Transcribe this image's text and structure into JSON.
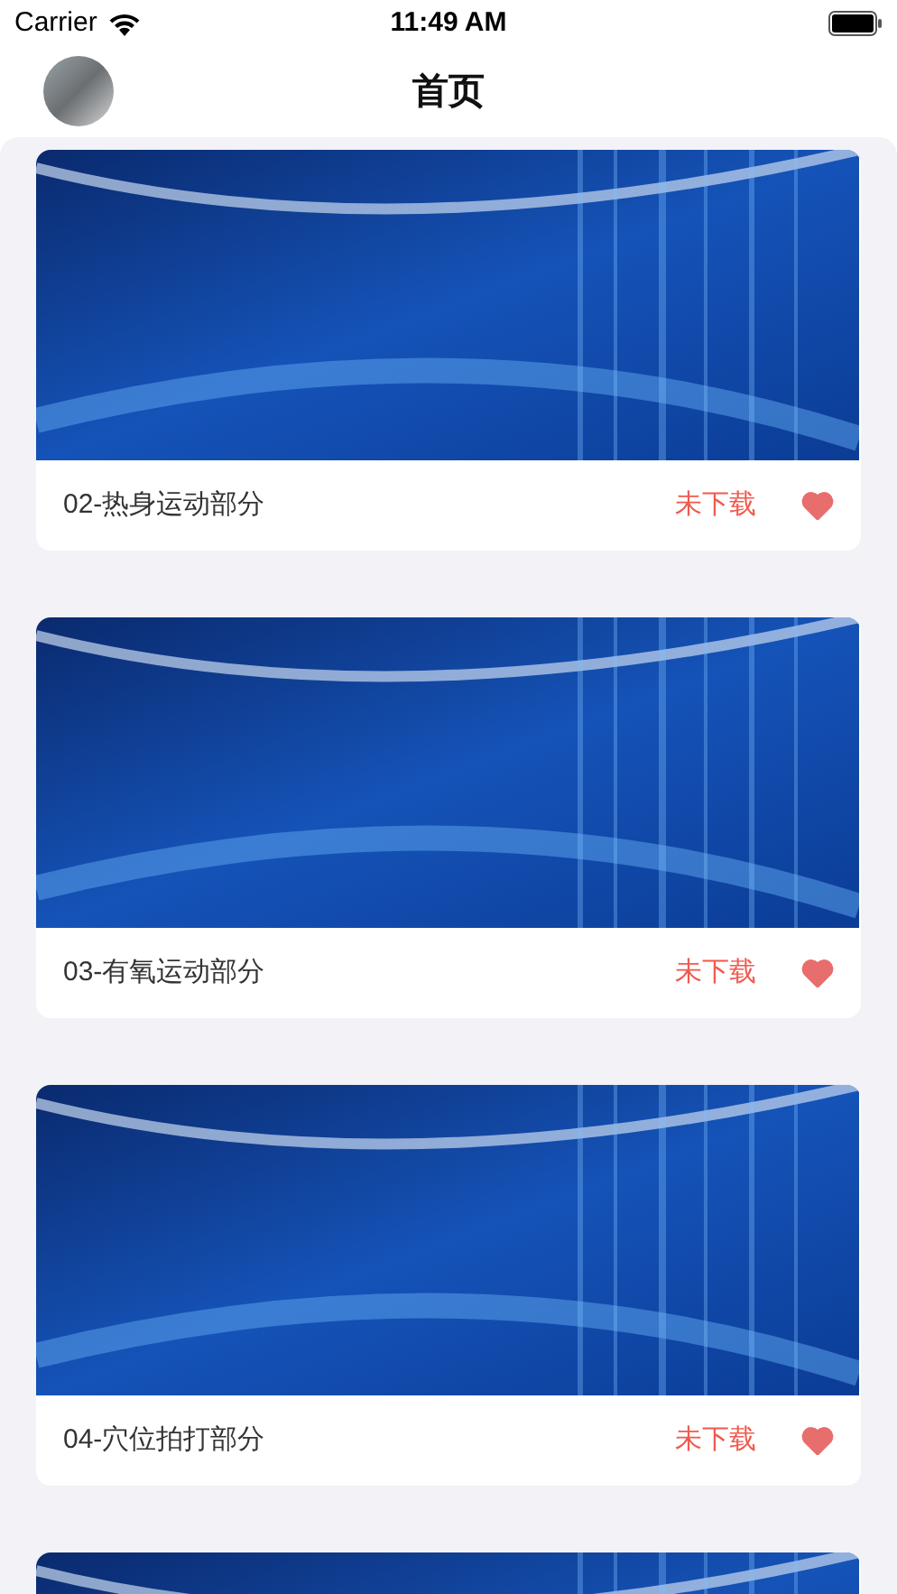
{
  "status_bar": {
    "carrier": "Carrier",
    "time": "11:49 AM"
  },
  "nav": {
    "title": "首页"
  },
  "videos": [
    {
      "kind": "full",
      "title": "02-热身运动部分",
      "download_status": "未下载",
      "favorite": true
    },
    {
      "kind": "full",
      "title": "03-有氧运动部分",
      "download_status": "未下载",
      "favorite": true
    },
    {
      "kind": "full",
      "title": "04-穴位拍打部分",
      "download_status": "未下载",
      "favorite": true
    },
    {
      "kind": "partial"
    }
  ]
}
